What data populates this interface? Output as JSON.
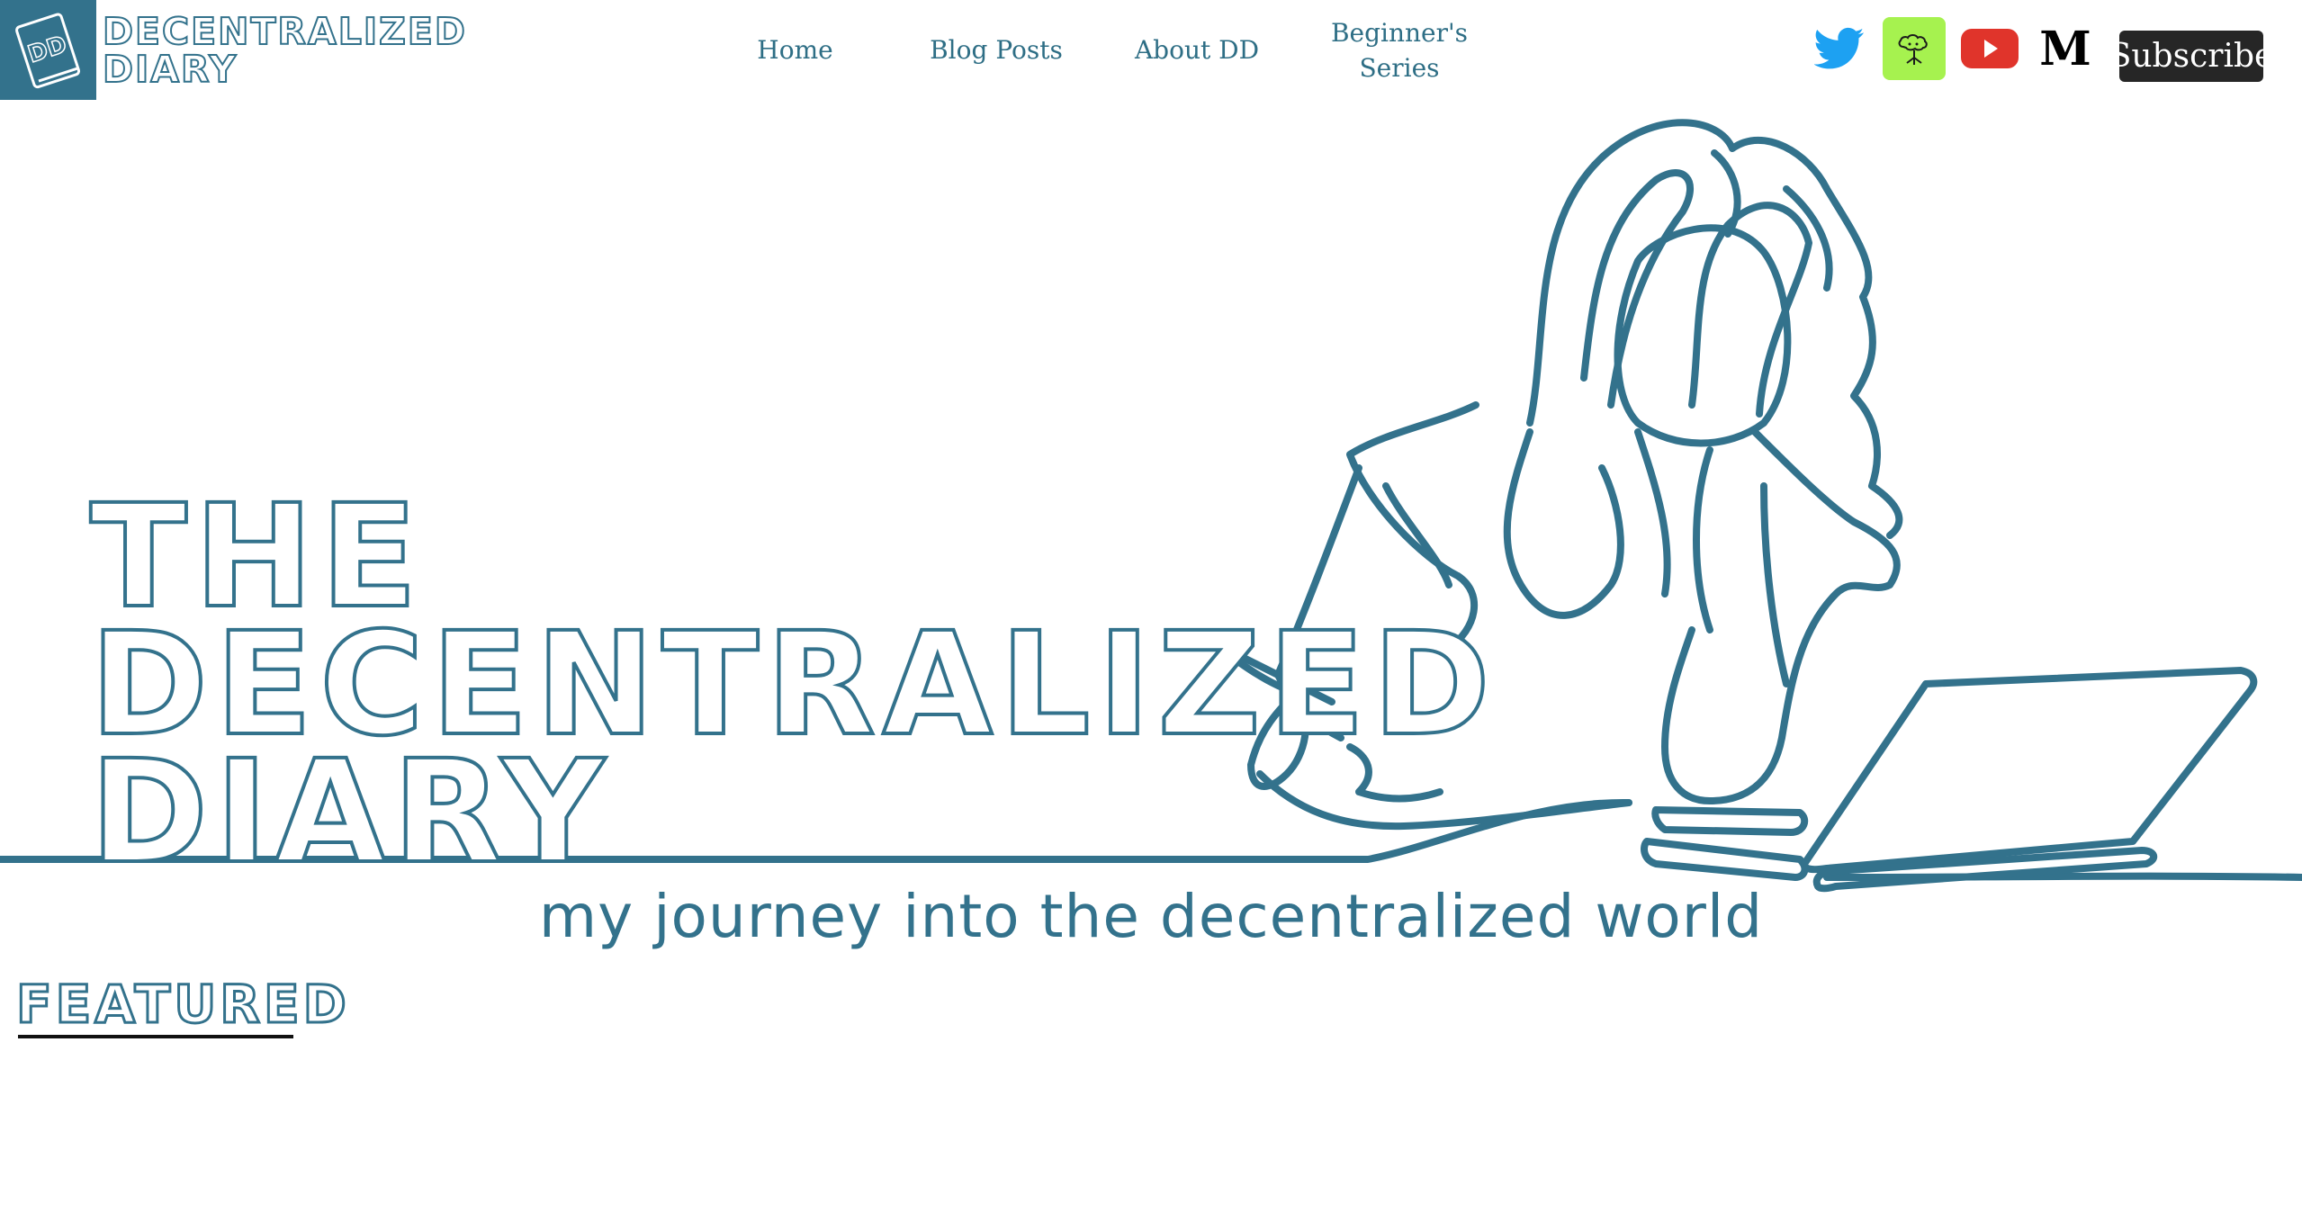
{
  "site": {
    "logo_monogram": "DD",
    "logo_line1": "DECENTRALIZED",
    "logo_line2": "DIARY"
  },
  "nav": {
    "home": "Home",
    "blog_posts": "Blog Posts",
    "about": "About DD",
    "beginners_line1": "Beginner's",
    "beginners_line2": "Series"
  },
  "social": {
    "icons": [
      "twitter-icon",
      "linktree-icon",
      "youtube-icon",
      "medium-icon"
    ],
    "medium_letter": "M",
    "subscribe_label": "Subscribe"
  },
  "hero": {
    "title_line1": "THE",
    "title_line2": "DECENTRALIZED",
    "title_line3": "DIARY",
    "tagline": "my journey into the decentralized world"
  },
  "featured": {
    "heading": "FEATURED"
  },
  "colors": {
    "brand": "#33728c",
    "twitter": "#1da1f2",
    "linktree": "#a6f24f",
    "youtube": "#e0342b",
    "subscribe_bg": "#262626"
  }
}
